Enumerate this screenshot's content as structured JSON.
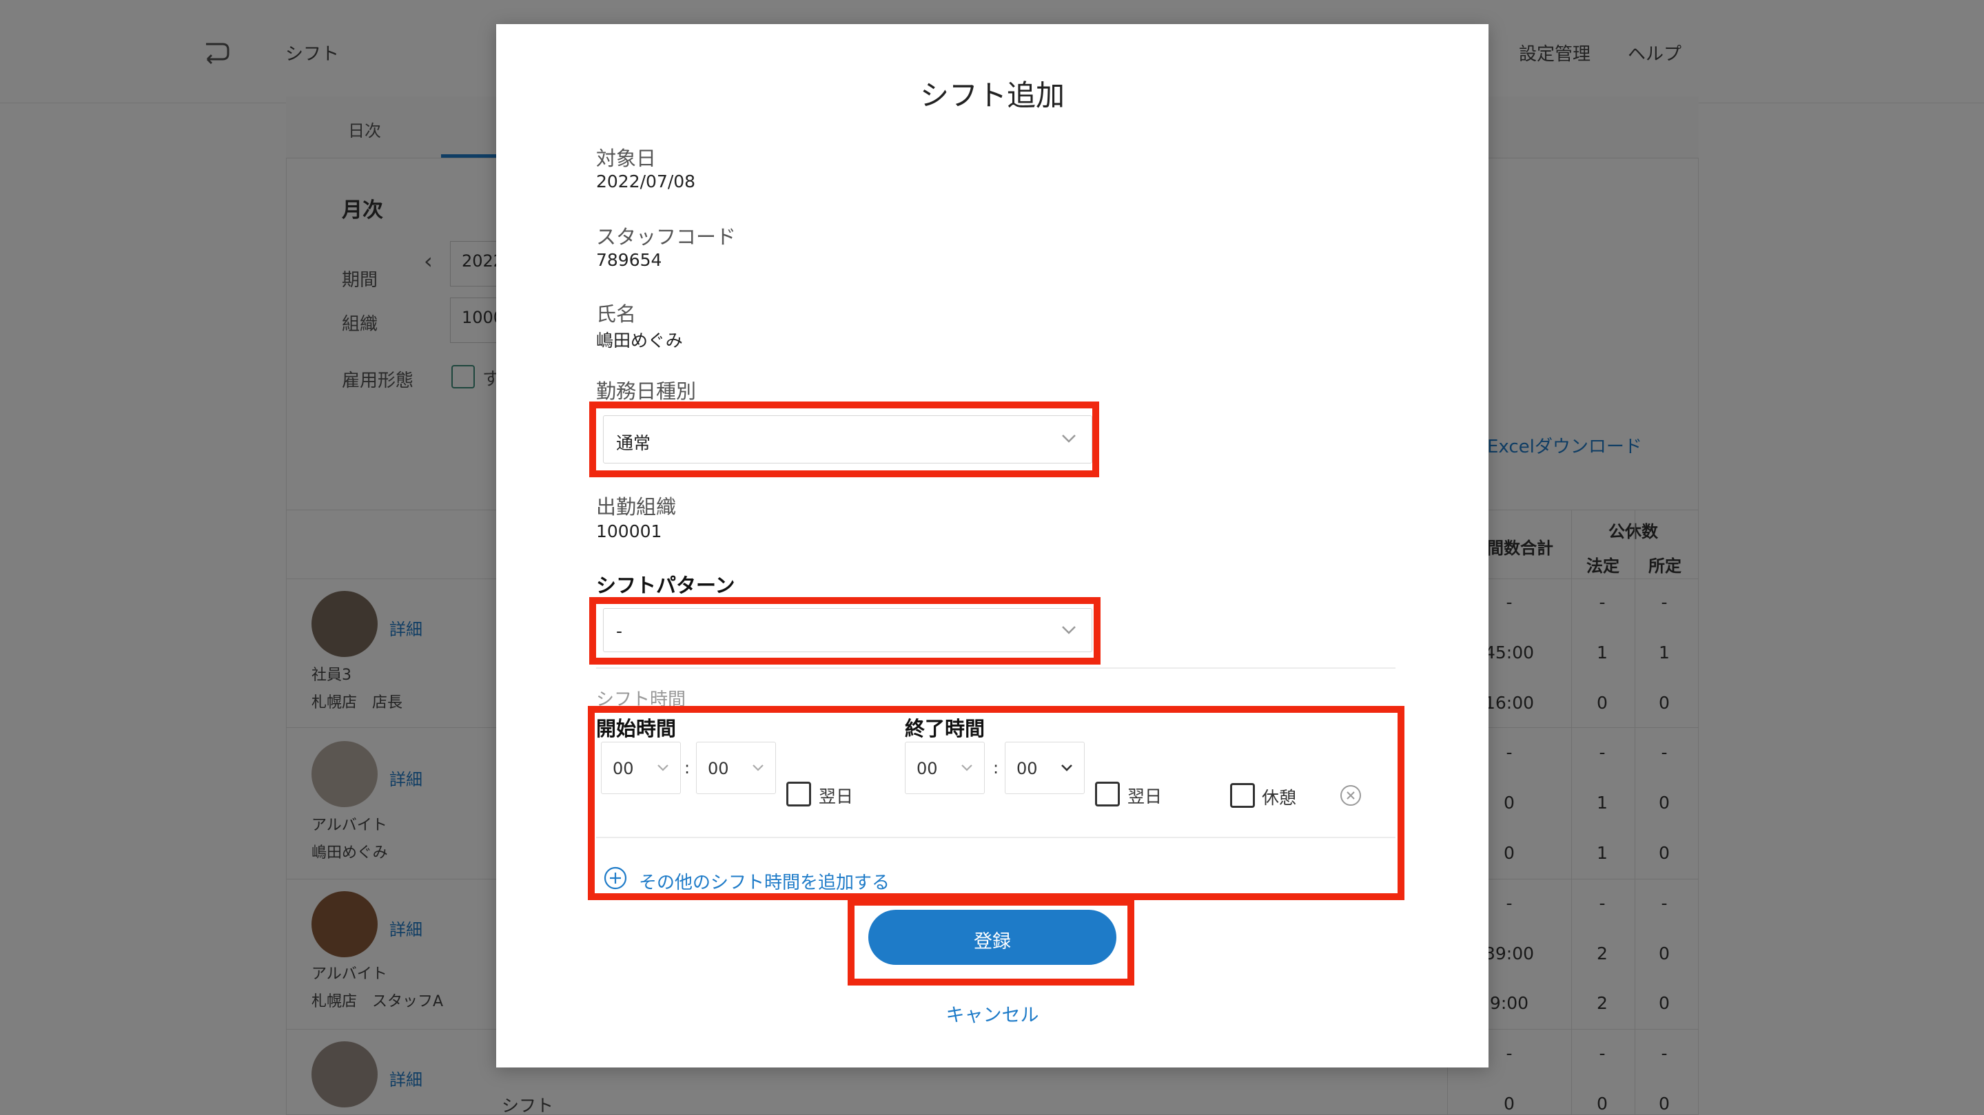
{
  "background": {
    "breadcrumb": "シフト",
    "nav_settings": "設定管理",
    "nav_help": "ヘルプ",
    "tab_daily": "日次",
    "section_title": "月次",
    "label_period": "期間",
    "label_org": "組織",
    "label_employment": "雇用形態",
    "period_value": "2022",
    "org_value": "1000",
    "employment_value": "す",
    "excel_download": "Excelダウンロード",
    "col_total": "間数合計",
    "col_holidays": "公休数",
    "col_legal": "法定",
    "col_prescribed": "所定",
    "detail_label": "詳細",
    "shift_label": "シフト",
    "employees": [
      {
        "role": "社員3",
        "store": "札幌店　店長"
      },
      {
        "role": "アルバイト",
        "store": "嶋田めぐみ"
      },
      {
        "role": "アルバイト",
        "store": "札幌店　スタッフA"
      }
    ],
    "rows": [
      [
        "-",
        "-",
        "-"
      ],
      [
        "45:00",
        "1",
        "1"
      ],
      [
        "16:00",
        "0",
        "0"
      ],
      [
        "-",
        "-",
        "-"
      ],
      [
        "0",
        "1",
        "0"
      ],
      [
        "0",
        "1",
        "0"
      ],
      [
        "-",
        "-",
        "-"
      ],
      [
        "39:00",
        "2",
        "0"
      ],
      [
        "9:00",
        "2",
        "0"
      ],
      [
        "-",
        "-",
        "-"
      ],
      [
        "0",
        "0",
        "0"
      ]
    ]
  },
  "modal": {
    "title": "シフト追加",
    "target_date_label": "対象日",
    "target_date_value": "2022/07/08",
    "staff_code_label": "スタッフコード",
    "staff_code_value": "789654",
    "name_label": "氏名",
    "name_value": "嶋田めぐみ",
    "workday_type_label": "勤務日種別",
    "workday_type_value": "通常",
    "org_label": "出勤組織",
    "org_value": "100001",
    "shift_pattern_label": "シフトパターン",
    "shift_pattern_value": "-",
    "shift_time_label": "シフト時間",
    "start_time_label": "開始時間",
    "end_time_label": "終了時間",
    "start_hour": "00",
    "start_minute": "00",
    "end_hour": "00",
    "end_minute": "00",
    "colon": ":",
    "next_day_label": "翌日",
    "break_label": "休憩",
    "add_shift_time": "その他のシフト時間を追加する",
    "submit_label": "登録",
    "cancel_label": "キャンセル"
  },
  "colors": {
    "accent": "#1e7bc8",
    "highlight": "#f0280f",
    "overlay": "rgba(0,0,0,0.5)"
  }
}
